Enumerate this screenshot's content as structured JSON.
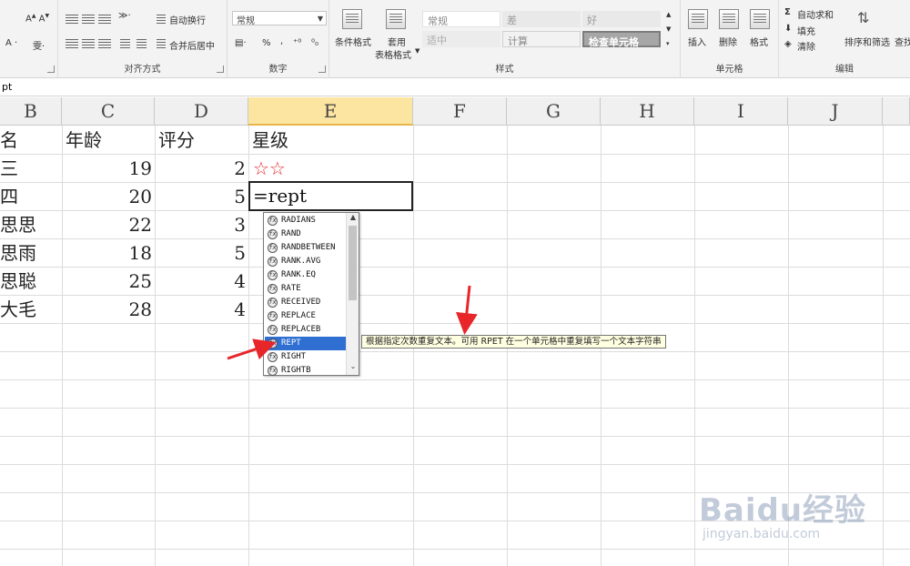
{
  "ribbon": {
    "alignment": {
      "wrap_label": "自动换行",
      "merge_label": "合并后居中",
      "group_label": "对齐方式"
    },
    "number": {
      "format_value": "常规",
      "percent_label": "%",
      "comma_label": ",",
      "group_label": "数字"
    },
    "styles": {
      "conditional_label": "条件格式",
      "table_label_1": "套用",
      "table_label_2": "表格格式",
      "cells": [
        "常规",
        "差",
        "好",
        "适中",
        "计算",
        "检查单元格"
      ],
      "group_label": "样式"
    },
    "cells_group": {
      "insert_label": "插入",
      "delete_label": "删除",
      "format_label": "格式",
      "group_label": "单元格"
    },
    "editing": {
      "autosum_label": "自动求和",
      "fill_label": "填充",
      "clear_label": "清除",
      "sort_label": "排序和筛选",
      "find_label": "查找",
      "group_label": "编辑"
    }
  },
  "formula_bar": {
    "content": "pt"
  },
  "columns": [
    "B",
    "C",
    "D",
    "E",
    "F",
    "G",
    "H",
    "I",
    "J"
  ],
  "active_column": "E",
  "rows": [
    {
      "b": "名",
      "c": "年龄",
      "d": "评分",
      "e": "星级"
    },
    {
      "b": "三",
      "c": "19",
      "d": "2",
      "e": "☆☆"
    },
    {
      "b": "四",
      "c": "20",
      "d": "5",
      "e": ""
    },
    {
      "b": "思思",
      "c": "22",
      "d": "3",
      "e": ""
    },
    {
      "b": "思雨",
      "c": "18",
      "d": "5",
      "e": ""
    },
    {
      "b": "思聪",
      "c": "25",
      "d": "4",
      "e": ""
    },
    {
      "b": "大毛",
      "c": "28",
      "d": "4",
      "e": ""
    }
  ],
  "editing_cell": {
    "value": "=rept"
  },
  "autocomplete": {
    "items": [
      "RADIANS",
      "RAND",
      "RANDBETWEEN",
      "RANK.AVG",
      "RANK.EQ",
      "RATE",
      "RECEIVED",
      "REPLACE",
      "REPLACEB",
      "REPT",
      "RIGHT",
      "RIGHTB"
    ],
    "selected_index": 9
  },
  "tooltip": {
    "text": "根据指定次数重复文本。可用 RPET 在一个单元格中重复填写一个文本字符串"
  },
  "watermark": {
    "brand": "Baidu经验",
    "url": "jingyan.baidu.com"
  },
  "colors": {
    "accent_header": "#fce4a1",
    "selection": "#2f6fd2",
    "stars": "#e3262a",
    "arrow": "#e8262a"
  }
}
